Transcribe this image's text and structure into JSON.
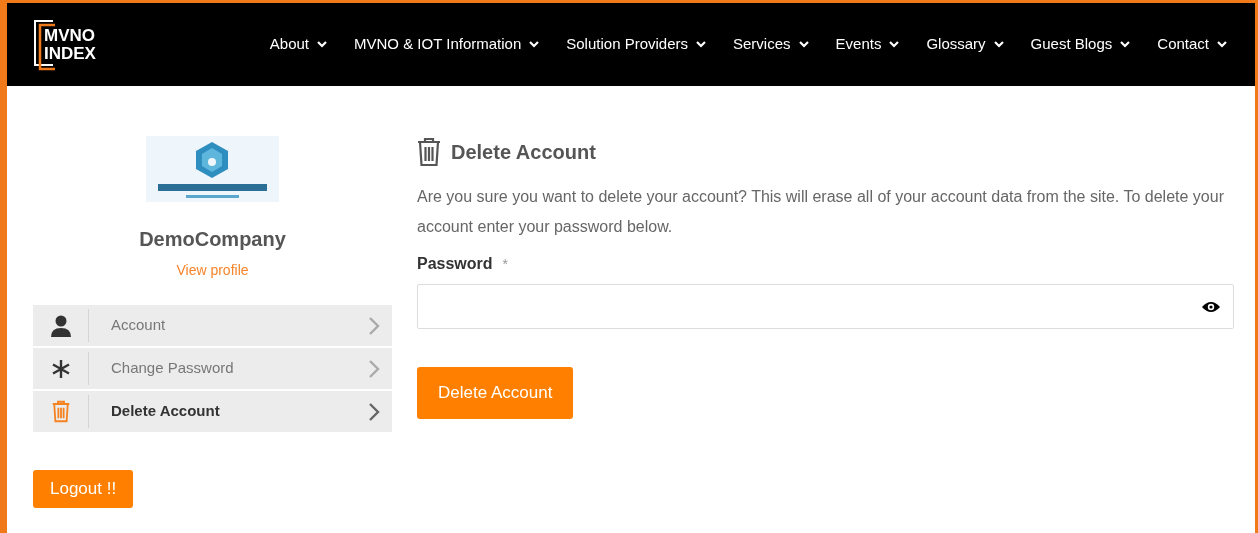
{
  "brand": {
    "lines": [
      "MVNO",
      "INDEX"
    ]
  },
  "nav": [
    {
      "label": "About"
    },
    {
      "label": "MVNO & IOT Information"
    },
    {
      "label": "Solution Providers"
    },
    {
      "label": "Services"
    },
    {
      "label": "Events"
    },
    {
      "label": "Glossary"
    },
    {
      "label": "Guest Blogs"
    },
    {
      "label": "Contact"
    }
  ],
  "profile": {
    "name": "DemoCompany",
    "link": "View profile"
  },
  "menu": [
    {
      "kind": "user",
      "label": "Account",
      "selected": false
    },
    {
      "kind": "asterisk",
      "label": "Change Password",
      "selected": false
    },
    {
      "kind": "trash",
      "label": "Delete Account",
      "selected": true
    }
  ],
  "logout": "Logout !!",
  "panel": {
    "title": "Delete Account",
    "text": "Are you sure you want to delete your account? This will erase all of your account data from the site. To delete your account enter your password below.",
    "field_label": "Password",
    "required_mark": "*",
    "button": "Delete Account"
  }
}
